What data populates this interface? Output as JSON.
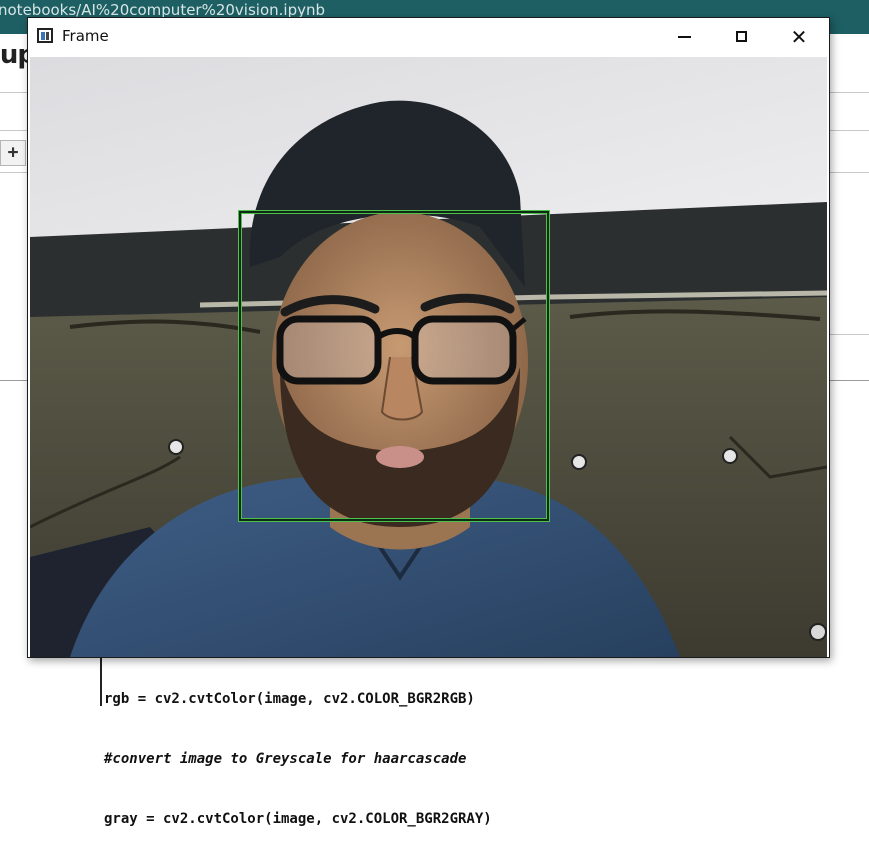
{
  "background": {
    "url_fragment": "notebooks/AI%20computer%20vision.ipynb",
    "logo_text": "jup",
    "toolbar_add_label": "+",
    "code_lines": [
      "rgb = cv2.cvtColor(image, cv2.COLOR_BGR2RGB)",
      "#convert image to Greyscale for haarcascade",
      "gray = cv2.cvtColor(image, cv2.COLOR_BGR2GRAY)"
    ]
  },
  "window": {
    "title": "Frame",
    "minimize_icon": "minimize-icon",
    "maximize_icon": "maximize-icon",
    "close_icon": "close-icon",
    "close_glyph": "✕"
  },
  "frame": {
    "content": "webcam-feed",
    "detection_box_color": "#4cc24c"
  }
}
